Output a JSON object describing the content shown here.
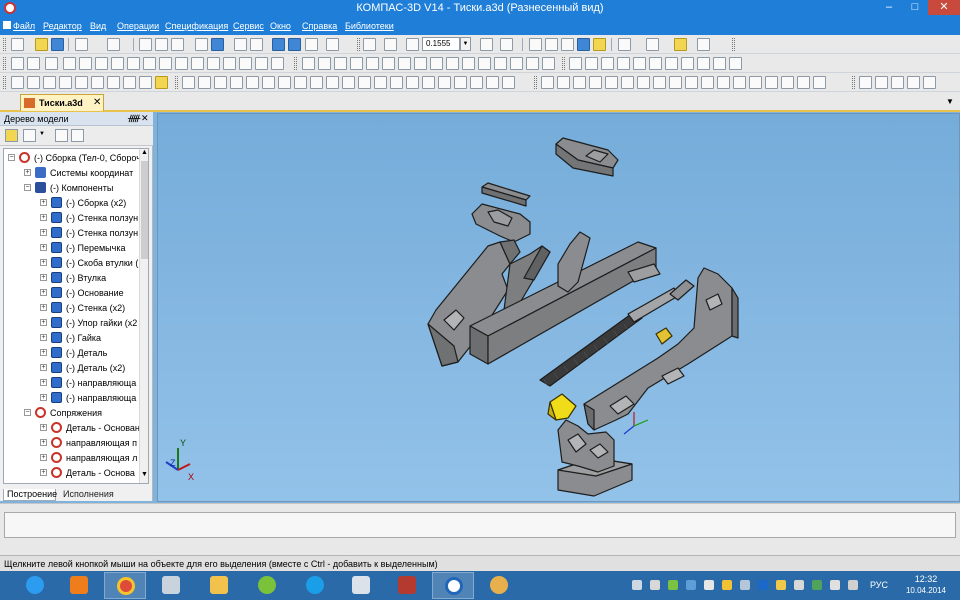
{
  "window": {
    "title": "КОМПАС-3D V14 - Тиски.a3d (Разнесенный вид)",
    "min_glyph": "–",
    "max_glyph": "□",
    "close_glyph": "✕"
  },
  "menu": {
    "items": [
      "Файл",
      "Редактор",
      "Вид",
      "Операции",
      "Спецификация",
      "Сервис",
      "Окно",
      "Справка",
      "Библиотеки"
    ]
  },
  "toolbar": {
    "zoom_value": "0.1555",
    "dropdown_glyph": "▼"
  },
  "document_tab": {
    "label": "Тиски.a3d",
    "close_glyph": "✕",
    "menu_glyph": "▼"
  },
  "tree_panel": {
    "title": "Дерево модели",
    "pin_glyph": "ᚏ",
    "close_glyph": "✕",
    "expand_plus": "+",
    "expand_minus": "−",
    "scroll_up": "▲",
    "scroll_down": "▼",
    "rows": [
      {
        "label": "(-) Сборка (Тел-0, Сбороч",
        "icon": "assembly-root-icon",
        "depth": 0,
        "expanded": true
      },
      {
        "label": "Системы координат",
        "icon": "coordinate-systems-icon",
        "depth": 1,
        "expanded": false
      },
      {
        "label": "(-) Компоненты",
        "icon": "components-icon",
        "depth": 1,
        "expanded": true
      },
      {
        "label": "(-) Сборка (x2)",
        "icon": "subassembly-icon",
        "depth": 2,
        "expanded": false
      },
      {
        "label": "(-) Стенка ползун",
        "icon": "part-icon",
        "depth": 2,
        "expanded": false
      },
      {
        "label": "(-) Стенка ползун",
        "icon": "part-icon",
        "depth": 2,
        "expanded": false
      },
      {
        "label": "(-) Перемычка",
        "icon": "part-icon",
        "depth": 2,
        "expanded": false
      },
      {
        "label": "(-) Скоба втулки (",
        "icon": "part-icon",
        "depth": 2,
        "expanded": false
      },
      {
        "label": "(-) Втулка",
        "icon": "part-icon",
        "depth": 2,
        "expanded": false
      },
      {
        "label": "(-) Основание",
        "icon": "part-icon",
        "depth": 2,
        "expanded": false
      },
      {
        "label": "(-) Стенка (x2)",
        "icon": "part-icon",
        "depth": 2,
        "expanded": false
      },
      {
        "label": "(-) Упор гайки (x2",
        "icon": "part-icon",
        "depth": 2,
        "expanded": false
      },
      {
        "label": "(-) Гайка",
        "icon": "part-icon",
        "depth": 2,
        "expanded": false
      },
      {
        "label": "(-) Деталь",
        "icon": "part-icon",
        "depth": 2,
        "expanded": false
      },
      {
        "label": "(-) Деталь (x2)",
        "icon": "part-icon",
        "depth": 2,
        "expanded": false
      },
      {
        "label": "(-) направляюща",
        "icon": "part-icon",
        "depth": 2,
        "expanded": false
      },
      {
        "label": "(-) направляюща",
        "icon": "part-icon",
        "depth": 2,
        "expanded": false
      },
      {
        "label": "Сопряжения",
        "icon": "mates-icon",
        "depth": 1,
        "expanded": true
      },
      {
        "label": "Деталь - Основан",
        "icon": "mate-icon",
        "depth": 2,
        "expanded": false
      },
      {
        "label": "направляющая п",
        "icon": "mate-icon",
        "depth": 2,
        "expanded": false
      },
      {
        "label": "направляющая л",
        "icon": "mate-icon",
        "depth": 2,
        "expanded": false
      },
      {
        "label": "Деталь - Основа",
        "icon": "mate-icon",
        "depth": 2,
        "expanded": false
      }
    ],
    "tabs": [
      "Построение",
      "Исполнения"
    ]
  },
  "viewport": {
    "triad_labels": {
      "x": "X",
      "y": "Y",
      "z": "Z"
    }
  },
  "status": {
    "text": "Щелкните левой кнопкой мыши на объекте для его выделения (вместе с Ctrl - добавить к выделенным)"
  },
  "taskbar": {
    "apps": [
      "internet-explorer-icon",
      "media-player-icon",
      "chrome-icon",
      "calculator-icon",
      "file-explorer-icon",
      "icq-icon",
      "skype-icon",
      "network-drive-icon",
      "access-icon",
      "kompas-icon",
      "paint-icon"
    ],
    "tray_lang": "РУС",
    "time": "12:32",
    "date": "10.04.2014"
  }
}
